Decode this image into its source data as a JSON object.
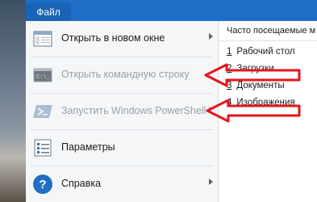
{
  "ribbon": {
    "file_tab": "Файл"
  },
  "menu": {
    "items": [
      {
        "label": "Открыть в новом окне",
        "icon": "new-window-icon"
      },
      {
        "label": "Открыть командную строку",
        "icon": "command-prompt-icon"
      },
      {
        "label": "Запустить Windows PowerShell",
        "icon": "powershell-icon"
      },
      {
        "label": "Параметры",
        "icon": "options-icon"
      },
      {
        "label": "Справка",
        "icon": "help-icon"
      }
    ],
    "help_glyph": "?"
  },
  "recent": {
    "title": "Часто посещаемые м",
    "items": [
      {
        "num": "1",
        "label": "Рабочий стол"
      },
      {
        "num": "2",
        "label": "Загрузки"
      },
      {
        "num": "3",
        "label": "Документы"
      },
      {
        "num": "4",
        "label": "Изображения"
      }
    ]
  },
  "colors": {
    "ribbon": "#1e6ec8",
    "annotation_arrow": "#e3161c"
  }
}
